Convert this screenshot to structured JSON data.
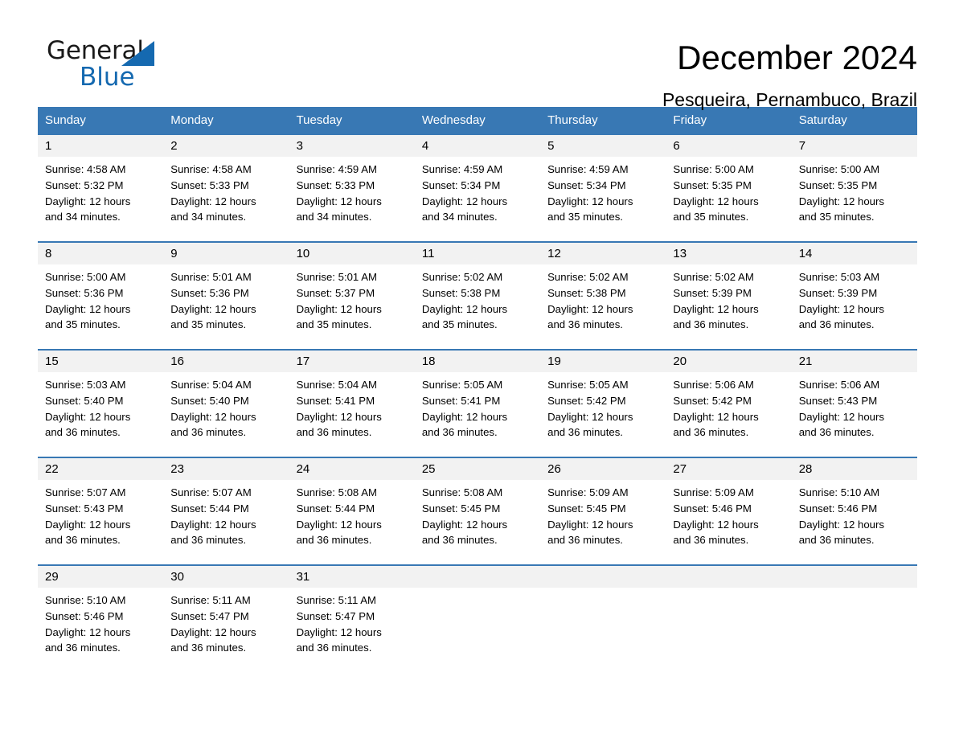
{
  "brand": {
    "name_part1": "General",
    "name_part2": "Blue",
    "logo_icon": "triangle-icon",
    "accent_color": "#1569b0"
  },
  "header": {
    "title": "December 2024",
    "subtitle": "Pesqueira, Pernambuco, Brazil"
  },
  "theme": {
    "header_blue": "#3878b4",
    "daynum_gray": "#f2f2f2"
  },
  "calendar": {
    "day_headers": [
      "Sunday",
      "Monday",
      "Tuesday",
      "Wednesday",
      "Thursday",
      "Friday",
      "Saturday"
    ],
    "weeks": [
      [
        {
          "day": "1",
          "sunrise": "Sunrise: 4:58 AM",
          "sunset": "Sunset: 5:32 PM",
          "daylight1": "Daylight: 12 hours",
          "daylight2": "and 34 minutes."
        },
        {
          "day": "2",
          "sunrise": "Sunrise: 4:58 AM",
          "sunset": "Sunset: 5:33 PM",
          "daylight1": "Daylight: 12 hours",
          "daylight2": "and 34 minutes."
        },
        {
          "day": "3",
          "sunrise": "Sunrise: 4:59 AM",
          "sunset": "Sunset: 5:33 PM",
          "daylight1": "Daylight: 12 hours",
          "daylight2": "and 34 minutes."
        },
        {
          "day": "4",
          "sunrise": "Sunrise: 4:59 AM",
          "sunset": "Sunset: 5:34 PM",
          "daylight1": "Daylight: 12 hours",
          "daylight2": "and 34 minutes."
        },
        {
          "day": "5",
          "sunrise": "Sunrise: 4:59 AM",
          "sunset": "Sunset: 5:34 PM",
          "daylight1": "Daylight: 12 hours",
          "daylight2": "and 35 minutes."
        },
        {
          "day": "6",
          "sunrise": "Sunrise: 5:00 AM",
          "sunset": "Sunset: 5:35 PM",
          "daylight1": "Daylight: 12 hours",
          "daylight2": "and 35 minutes."
        },
        {
          "day": "7",
          "sunrise": "Sunrise: 5:00 AM",
          "sunset": "Sunset: 5:35 PM",
          "daylight1": "Daylight: 12 hours",
          "daylight2": "and 35 minutes."
        }
      ],
      [
        {
          "day": "8",
          "sunrise": "Sunrise: 5:00 AM",
          "sunset": "Sunset: 5:36 PM",
          "daylight1": "Daylight: 12 hours",
          "daylight2": "and 35 minutes."
        },
        {
          "day": "9",
          "sunrise": "Sunrise: 5:01 AM",
          "sunset": "Sunset: 5:36 PM",
          "daylight1": "Daylight: 12 hours",
          "daylight2": "and 35 minutes."
        },
        {
          "day": "10",
          "sunrise": "Sunrise: 5:01 AM",
          "sunset": "Sunset: 5:37 PM",
          "daylight1": "Daylight: 12 hours",
          "daylight2": "and 35 minutes."
        },
        {
          "day": "11",
          "sunrise": "Sunrise: 5:02 AM",
          "sunset": "Sunset: 5:38 PM",
          "daylight1": "Daylight: 12 hours",
          "daylight2": "and 35 minutes."
        },
        {
          "day": "12",
          "sunrise": "Sunrise: 5:02 AM",
          "sunset": "Sunset: 5:38 PM",
          "daylight1": "Daylight: 12 hours",
          "daylight2": "and 36 minutes."
        },
        {
          "day": "13",
          "sunrise": "Sunrise: 5:02 AM",
          "sunset": "Sunset: 5:39 PM",
          "daylight1": "Daylight: 12 hours",
          "daylight2": "and 36 minutes."
        },
        {
          "day": "14",
          "sunrise": "Sunrise: 5:03 AM",
          "sunset": "Sunset: 5:39 PM",
          "daylight1": "Daylight: 12 hours",
          "daylight2": "and 36 minutes."
        }
      ],
      [
        {
          "day": "15",
          "sunrise": "Sunrise: 5:03 AM",
          "sunset": "Sunset: 5:40 PM",
          "daylight1": "Daylight: 12 hours",
          "daylight2": "and 36 minutes."
        },
        {
          "day": "16",
          "sunrise": "Sunrise: 5:04 AM",
          "sunset": "Sunset: 5:40 PM",
          "daylight1": "Daylight: 12 hours",
          "daylight2": "and 36 minutes."
        },
        {
          "day": "17",
          "sunrise": "Sunrise: 5:04 AM",
          "sunset": "Sunset: 5:41 PM",
          "daylight1": "Daylight: 12 hours",
          "daylight2": "and 36 minutes."
        },
        {
          "day": "18",
          "sunrise": "Sunrise: 5:05 AM",
          "sunset": "Sunset: 5:41 PM",
          "daylight1": "Daylight: 12 hours",
          "daylight2": "and 36 minutes."
        },
        {
          "day": "19",
          "sunrise": "Sunrise: 5:05 AM",
          "sunset": "Sunset: 5:42 PM",
          "daylight1": "Daylight: 12 hours",
          "daylight2": "and 36 minutes."
        },
        {
          "day": "20",
          "sunrise": "Sunrise: 5:06 AM",
          "sunset": "Sunset: 5:42 PM",
          "daylight1": "Daylight: 12 hours",
          "daylight2": "and 36 minutes."
        },
        {
          "day": "21",
          "sunrise": "Sunrise: 5:06 AM",
          "sunset": "Sunset: 5:43 PM",
          "daylight1": "Daylight: 12 hours",
          "daylight2": "and 36 minutes."
        }
      ],
      [
        {
          "day": "22",
          "sunrise": "Sunrise: 5:07 AM",
          "sunset": "Sunset: 5:43 PM",
          "daylight1": "Daylight: 12 hours",
          "daylight2": "and 36 minutes."
        },
        {
          "day": "23",
          "sunrise": "Sunrise: 5:07 AM",
          "sunset": "Sunset: 5:44 PM",
          "daylight1": "Daylight: 12 hours",
          "daylight2": "and 36 minutes."
        },
        {
          "day": "24",
          "sunrise": "Sunrise: 5:08 AM",
          "sunset": "Sunset: 5:44 PM",
          "daylight1": "Daylight: 12 hours",
          "daylight2": "and 36 minutes."
        },
        {
          "day": "25",
          "sunrise": "Sunrise: 5:08 AM",
          "sunset": "Sunset: 5:45 PM",
          "daylight1": "Daylight: 12 hours",
          "daylight2": "and 36 minutes."
        },
        {
          "day": "26",
          "sunrise": "Sunrise: 5:09 AM",
          "sunset": "Sunset: 5:45 PM",
          "daylight1": "Daylight: 12 hours",
          "daylight2": "and 36 minutes."
        },
        {
          "day": "27",
          "sunrise": "Sunrise: 5:09 AM",
          "sunset": "Sunset: 5:46 PM",
          "daylight1": "Daylight: 12 hours",
          "daylight2": "and 36 minutes."
        },
        {
          "day": "28",
          "sunrise": "Sunrise: 5:10 AM",
          "sunset": "Sunset: 5:46 PM",
          "daylight1": "Daylight: 12 hours",
          "daylight2": "and 36 minutes."
        }
      ],
      [
        {
          "day": "29",
          "sunrise": "Sunrise: 5:10 AM",
          "sunset": "Sunset: 5:46 PM",
          "daylight1": "Daylight: 12 hours",
          "daylight2": "and 36 minutes."
        },
        {
          "day": "30",
          "sunrise": "Sunrise: 5:11 AM",
          "sunset": "Sunset: 5:47 PM",
          "daylight1": "Daylight: 12 hours",
          "daylight2": "and 36 minutes."
        },
        {
          "day": "31",
          "sunrise": "Sunrise: 5:11 AM",
          "sunset": "Sunset: 5:47 PM",
          "daylight1": "Daylight: 12 hours",
          "daylight2": "and 36 minutes."
        },
        {
          "day": "",
          "sunrise": "",
          "sunset": "",
          "daylight1": "",
          "daylight2": ""
        },
        {
          "day": "",
          "sunrise": "",
          "sunset": "",
          "daylight1": "",
          "daylight2": ""
        },
        {
          "day": "",
          "sunrise": "",
          "sunset": "",
          "daylight1": "",
          "daylight2": ""
        },
        {
          "day": "",
          "sunrise": "",
          "sunset": "",
          "daylight1": "",
          "daylight2": ""
        }
      ]
    ]
  }
}
